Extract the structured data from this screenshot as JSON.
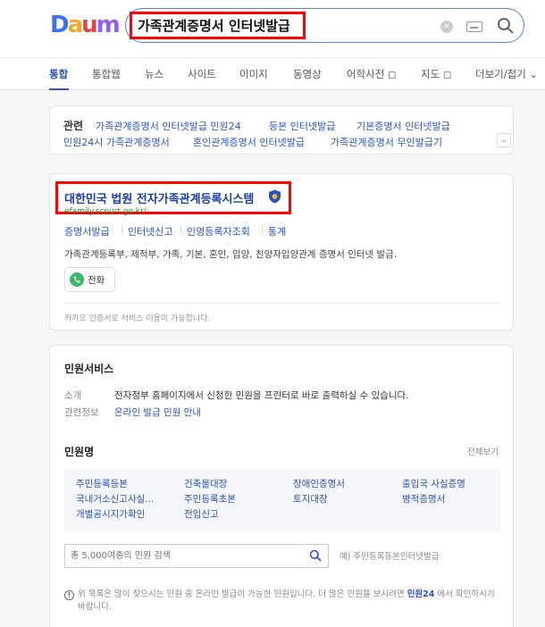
{
  "header": {
    "logo": "Daum",
    "search_query": "가족관계증명서 인터넷발급",
    "clear_label": "×"
  },
  "tabs": [
    {
      "label": "통합"
    },
    {
      "label": "통합웹"
    },
    {
      "label": "뉴스"
    },
    {
      "label": "사이트"
    },
    {
      "label": "이미지"
    },
    {
      "label": "동영상"
    },
    {
      "label": "어학사전 ◻"
    },
    {
      "label": "지도 ◻"
    },
    {
      "label": "더보기/접기 ⌄"
    }
  ],
  "related": {
    "label": "관련",
    "links": [
      "가족관계증명서 인터넷발급 민원24",
      "등본 인터넷발급",
      "기본증명서 인터넷발급",
      "민원24시 가족관계증명서",
      "혼인관계증명서 인터넷발급",
      "가족관계증명서 무인발급기"
    ],
    "expand_label": "⌄"
  },
  "site": {
    "title": "대한민국 법원 전자가족관계등록시스템",
    "url": "efamily.scourt.go.kr/",
    "sublinks": [
      "증명서발급",
      "인터넷신고",
      "인영등록자조회",
      "통계"
    ],
    "description": "가족관계등록부, 제적부, 가족, 기본, 혼인, 입양, 친양자입양관계 증명서 인터넷 발급.",
    "phone_label": "전화",
    "kakao_note": "카카오 인증서로 서비스 이용이 가능합니다."
  },
  "service": {
    "title": "민원서비스",
    "intro_label": "소개",
    "intro_text": "전자정부 홈페이지에서 신청한 민원을 프린터로 바로 출력하실 수 있습니다.",
    "info_label": "관련정보",
    "info_link": "온라인 발급 민원 안내",
    "list_title": "민원명",
    "see_all": "전체보기",
    "items": [
      "주민등록등본",
      "건축물대장",
      "장애인증명서",
      "출입국 사실증명",
      "국내거소신고사실...",
      "주민등록초본",
      "토지대장",
      "병적증명서",
      "개별공시지가확인",
      "전입신고"
    ],
    "search_placeholder": "총 5,000여종의 민원 검색",
    "example": "예) 주민등록등본인터넷발급",
    "notice_prefix": "위 목록은 많이 찾으시는 민원 중 온라인 발급이 가능한 민원입니다. 더 많은 민원을 보시려면 ",
    "notice_link": "민원24",
    "notice_suffix": " 에서 확인하시기 바랍니다."
  }
}
